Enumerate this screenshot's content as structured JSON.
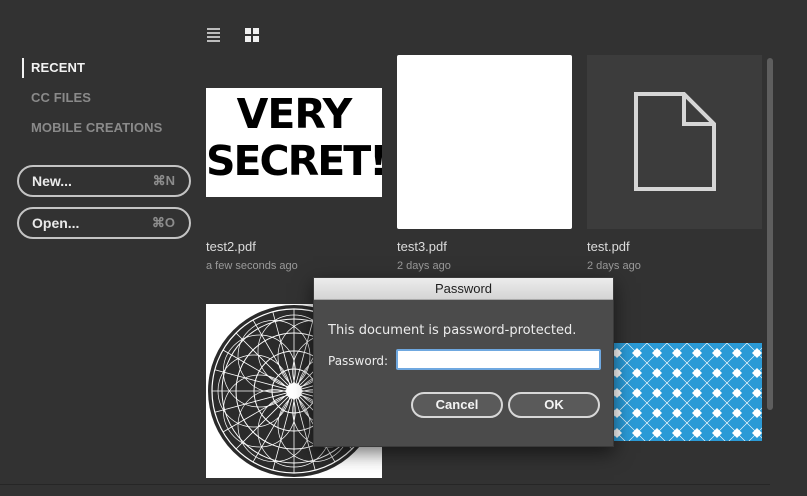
{
  "toolbar": {
    "list_view_icon": "list-icon",
    "grid_view_icon": "grid-icon"
  },
  "nav": {
    "items": [
      {
        "label": "RECENT",
        "active": true
      },
      {
        "label": "CC FILES",
        "active": false
      },
      {
        "label": "MOBILE CREATIONS",
        "active": false
      }
    ]
  },
  "actions": {
    "new_label": "New...",
    "new_shortcut": "⌘N",
    "open_label": "Open...",
    "open_shortcut": "⌘O"
  },
  "files": [
    {
      "name": "test2.pdf",
      "modified": "a few seconds ago",
      "thumb_text_1": "VERY",
      "thumb_text_2": "SECRET!"
    },
    {
      "name": "test3.pdf",
      "modified": "2 days ago"
    },
    {
      "name": "test.pdf",
      "modified": "2 days ago"
    }
  ],
  "dialog": {
    "title": "Password",
    "message": "This document is password-protected.",
    "password_label": "Password:",
    "password_value": "",
    "cancel_label": "Cancel",
    "ok_label": "OK"
  },
  "colors": {
    "background": "#323232",
    "pattern_blue": "#2a9ad6",
    "input_focus": "#6fa8e0"
  }
}
